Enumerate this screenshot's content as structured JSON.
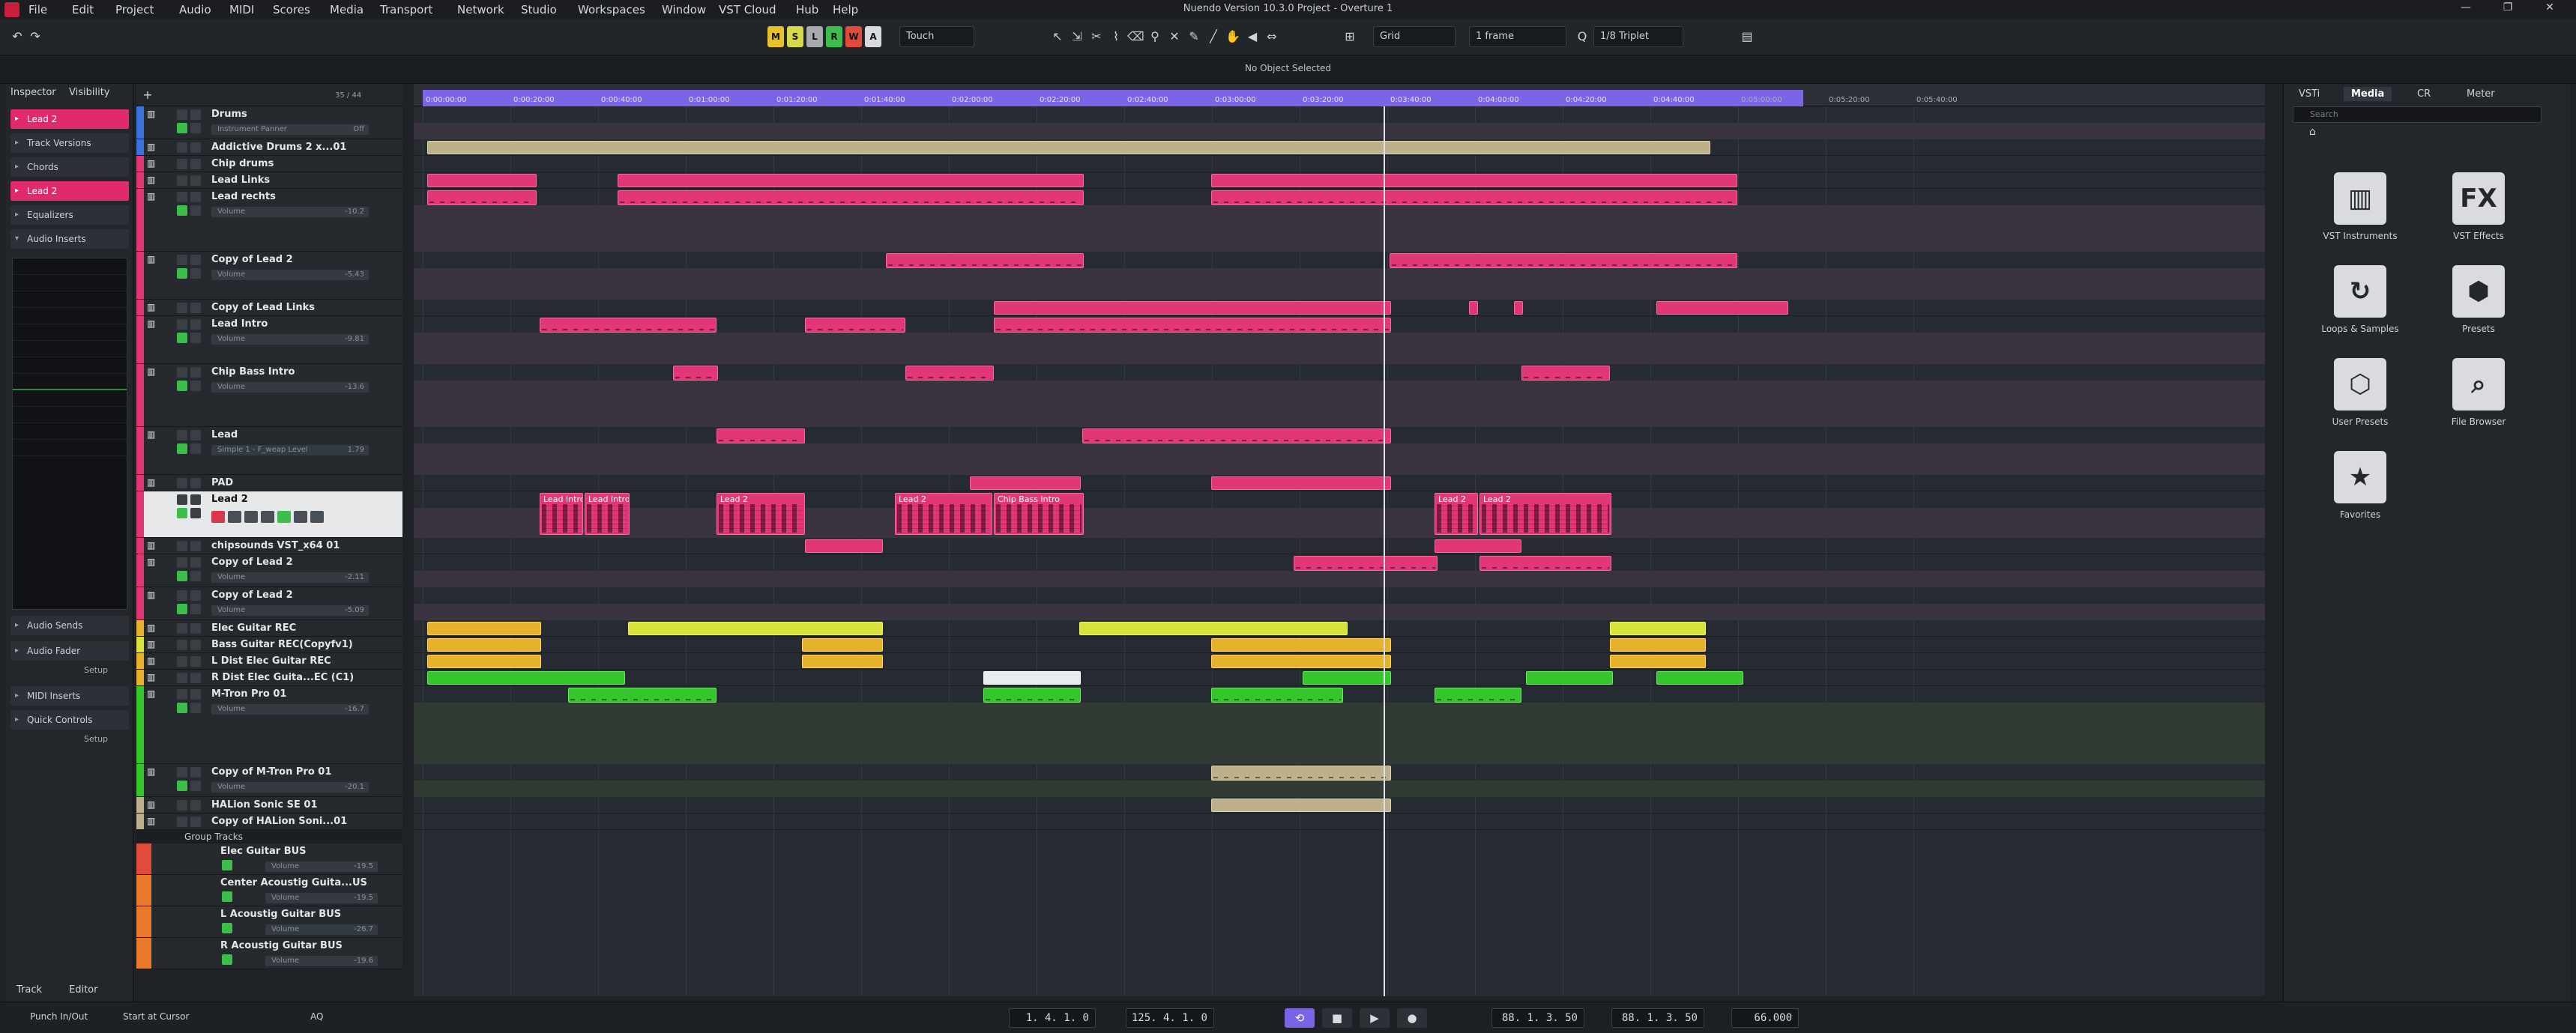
{
  "window": {
    "title": "Nuendo Version 10.3.0 Project - Overture 1",
    "menus": [
      "File",
      "Edit",
      "Project",
      "Audio",
      "MIDI",
      "Scores",
      "Media",
      "Transport",
      "Network",
      "Studio",
      "Workspaces",
      "Window",
      "VST Cloud",
      "Hub",
      "Help"
    ]
  },
  "toolbar": {
    "automation_mode": "Touch",
    "snap_type": "Grid",
    "grid_value": "1 frame",
    "quantize": "1/8 Triplet",
    "mode_buttons": [
      {
        "label": "M",
        "color": "#e8c02a"
      },
      {
        "label": "S",
        "color": "#d6d84a"
      },
      {
        "label": "L",
        "color": "#a6a9ad"
      },
      {
        "label": "R",
        "color": "#3cbf4a"
      },
      {
        "label": "W",
        "color": "#e24a3a"
      },
      {
        "label": "A",
        "color": "#d8dadd"
      }
    ]
  },
  "info": {
    "status": "No Object Selected"
  },
  "inspector": {
    "tabs": [
      "Inspector",
      "Visibility"
    ],
    "track_name": "Lead 2",
    "sections": [
      "Track Versions",
      "Chords",
      "Equalizers",
      "Audio Inserts"
    ],
    "lower_sections": [
      "Audio Sends",
      "Audio Fader",
      "MIDI Inserts",
      "Quick Controls"
    ],
    "setup_label": "Setup",
    "bottom_tabs": [
      "Track",
      "Editor"
    ]
  },
  "tracklist": {
    "count": "35 / 44",
    "tracks": [
      {
        "name": "Drums",
        "param": "Instrument Panner",
        "param_val": "Off",
        "color": "#3a73e0",
        "h": 44
      },
      {
        "name": "Addictive Drums 2 x...01",
        "color": "#3a73e0",
        "h": 22
      },
      {
        "name": "Chip drums",
        "color": "#e13777",
        "h": 22
      },
      {
        "name": "Lead Links",
        "color": "#e13777",
        "h": 22
      },
      {
        "name": "Lead rechts",
        "param": "Volume",
        "param_val": "-10.2",
        "color": "#e13777",
        "h": 84
      },
      {
        "name": "Copy of Lead 2",
        "param": "Volume",
        "param_val": "-5.43",
        "color": "#e13777",
        "h": 64
      },
      {
        "name": "Copy of Lead Links",
        "color": "#e13777",
        "h": 22
      },
      {
        "name": "Lead Intro",
        "param": "Volume",
        "param_val": "-9.81",
        "color": "#e13777",
        "h": 64
      },
      {
        "name": "Chip Bass Intro",
        "param": "Volume",
        "param_val": "-13.6",
        "color": "#e13777",
        "h": 84
      },
      {
        "name": "Lead",
        "param": "Simple 1 - F_weap Level",
        "param_val": "1.79",
        "color": "#e13777",
        "h": 64
      },
      {
        "name": "PAD",
        "color": "#e13777",
        "h": 22
      },
      {
        "name": "Lead 2",
        "color": "#e13777",
        "h": 62,
        "selected": true
      },
      {
        "name": "chipsounds VST_x64 01",
        "color": "#e13777",
        "h": 22
      },
      {
        "name": "Copy of Lead 2",
        "param": "Volume",
        "param_val": "-2.11",
        "color": "#e13777",
        "h": 44
      },
      {
        "name": "Copy of Lead 2",
        "param": "Volume",
        "param_val": "-5.09",
        "color": "#e13777",
        "h": 44
      },
      {
        "name": "Elec Guitar REC",
        "color": "#e8b12b",
        "h": 22
      },
      {
        "name": "Bass Guitar REC(Copyfv1)",
        "color": "#d7e23a",
        "h": 22
      },
      {
        "name": "L Dist Elec Guitar REC",
        "color": "#e8b12b",
        "h": 22
      },
      {
        "name": "R Dist Elec Guita...EC (C1)",
        "color": "#e8b12b",
        "h": 22
      },
      {
        "name": "M-Tron Pro 01",
        "param": "Volume",
        "param_val": "-16.7",
        "color": "#35c62c",
        "h": 104
      },
      {
        "name": "Copy of M-Tron Pro 01",
        "param": "Volume",
        "param_val": "-20.1",
        "color": "#35c62c",
        "h": 44
      },
      {
        "name": "HALion Sonic SE 01",
        "color": "#bdb18b",
        "h": 22
      },
      {
        "name": "Copy of HALion Soni...01",
        "color": "#bdb18b",
        "h": 22
      }
    ],
    "group_label": "Group Tracks",
    "groups": [
      {
        "name": "Elec Guitar BUS",
        "param": "Volume",
        "param_val": "-19.5",
        "color": "#e24a3a"
      },
      {
        "name": "Center Acoustig Guita...US",
        "param": "Volume",
        "param_val": "-19.5",
        "color": "#e87a2a"
      },
      {
        "name": "L Acoustig Guitar BUS",
        "param": "Volume",
        "param_val": "-26.7",
        "color": "#e87a2a"
      },
      {
        "name": "R Acoustig Guitar BUS",
        "param": "Volume",
        "param_val": "-19.6",
        "color": "#e87a2a"
      }
    ]
  },
  "ruler": {
    "labels": [
      "0:00:00:00",
      "0:00:20:00",
      "0:00:40:00",
      "0:01:00:00",
      "0:01:20:00",
      "0:01:40:00",
      "0:02:00:00",
      "0:02:20:00",
      "0:02:40:00",
      "0:03:00:00",
      "0:03:20:00",
      "0:03:40:00",
      "0:04:00:00",
      "0:04:20:00",
      "0:04:40:00",
      "0:05:00:00",
      "0:05:20:00",
      "0:05:40:00"
    ],
    "cycle_end": 0.746
  },
  "event_names": {
    "lead_intro": "Lead Intro",
    "lead_2": "Lead 2",
    "chip_bass_intro": "Chip Bass Intro"
  },
  "media": {
    "tabs": [
      "VSTi",
      "Media",
      "CR",
      "Meter"
    ],
    "search_placeholder": "Search",
    "tiles": [
      {
        "label": "VST Instruments",
        "icon": "piano-icon",
        "glyph": "▥"
      },
      {
        "label": "VST Effects",
        "icon": "fx-icon",
        "glyph": "FX"
      },
      {
        "label": "Loops & Samples",
        "icon": "loop-icon",
        "glyph": "↻"
      },
      {
        "label": "Presets",
        "icon": "presets-icon",
        "glyph": "⬢"
      },
      {
        "label": "User Presets",
        "icon": "user-presets-icon",
        "glyph": "⬡"
      },
      {
        "label": "File Browser",
        "icon": "file-browser-icon",
        "glyph": "⌕"
      },
      {
        "label": "Favorites",
        "icon": "star-icon",
        "glyph": "★"
      }
    ]
  },
  "transport": {
    "punch": "Punch In/Out",
    "start_mode": "Start at Cursor",
    "left_locator": "1. 4. 1.   0",
    "right_locator": "125. 4. 1.   0",
    "position_primary": "88. 1. 3. 50",
    "position_secondary": "88. 1. 3. 50",
    "tempo": "66.000",
    "aq": "AQ"
  }
}
